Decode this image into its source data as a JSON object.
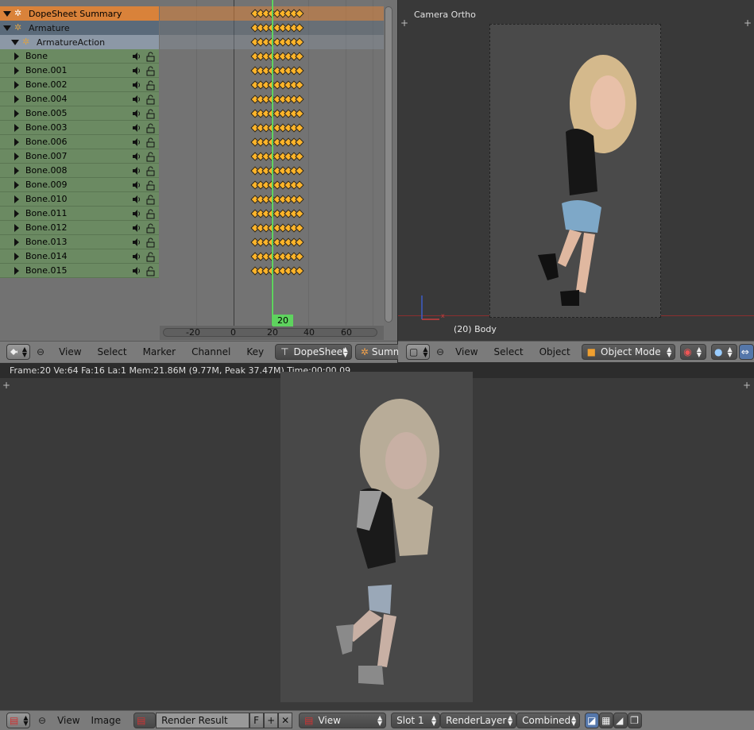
{
  "dopesheet": {
    "channels": [
      {
        "label": "DopeSheet Summary",
        "kind": "summary"
      },
      {
        "label": "Armature",
        "kind": "arm"
      },
      {
        "label": "ArmatureAction",
        "kind": "action"
      },
      {
        "label": "Bone",
        "kind": "bone"
      },
      {
        "label": "Bone.001",
        "kind": "bone"
      },
      {
        "label": "Bone.002",
        "kind": "bone"
      },
      {
        "label": "Bone.004",
        "kind": "bone"
      },
      {
        "label": "Bone.005",
        "kind": "bone"
      },
      {
        "label": "Bone.003",
        "kind": "bone"
      },
      {
        "label": "Bone.006",
        "kind": "bone"
      },
      {
        "label": "Bone.007",
        "kind": "bone"
      },
      {
        "label": "Bone.008",
        "kind": "bone"
      },
      {
        "label": "Bone.009",
        "kind": "bone"
      },
      {
        "label": "Bone.010",
        "kind": "bone"
      },
      {
        "label": "Bone.011",
        "kind": "bone"
      },
      {
        "label": "Bone.012",
        "kind": "bone"
      },
      {
        "label": "Bone.013",
        "kind": "bone"
      },
      {
        "label": "Bone.014",
        "kind": "bone"
      },
      {
        "label": "Bone.015",
        "kind": "bone"
      }
    ],
    "ruler_ticks": [
      "-20",
      "0",
      "20",
      "40",
      "60"
    ],
    "current_frame": "20",
    "header": {
      "menus": [
        "View",
        "Select",
        "Marker",
        "Channel",
        "Key"
      ],
      "mode": "DopeSheet",
      "summary": "Summary"
    }
  },
  "viewport": {
    "title": "Camera Ortho",
    "object_label": "(20) Body",
    "header": {
      "menus": [
        "View",
        "Select",
        "Object"
      ],
      "mode": "Object Mode"
    }
  },
  "status": {
    "text": "Frame:20 Ve:64 Fa:16 La:1 Mem:21.86M (9.77M, Peak 37.47M) Time:00:00.09"
  },
  "image_editor": {
    "header": {
      "menus": [
        "View",
        "Image"
      ],
      "image_name": "Render Result",
      "fake_user": "F",
      "view": "View",
      "slot": "Slot 1",
      "layer": "RenderLayer",
      "pass": "Combined"
    }
  },
  "colors": {
    "summary": "#d9823a",
    "bone_channel": "#6b8a62",
    "keyframe": "#ffb52a",
    "playhead": "#5ed35e"
  }
}
